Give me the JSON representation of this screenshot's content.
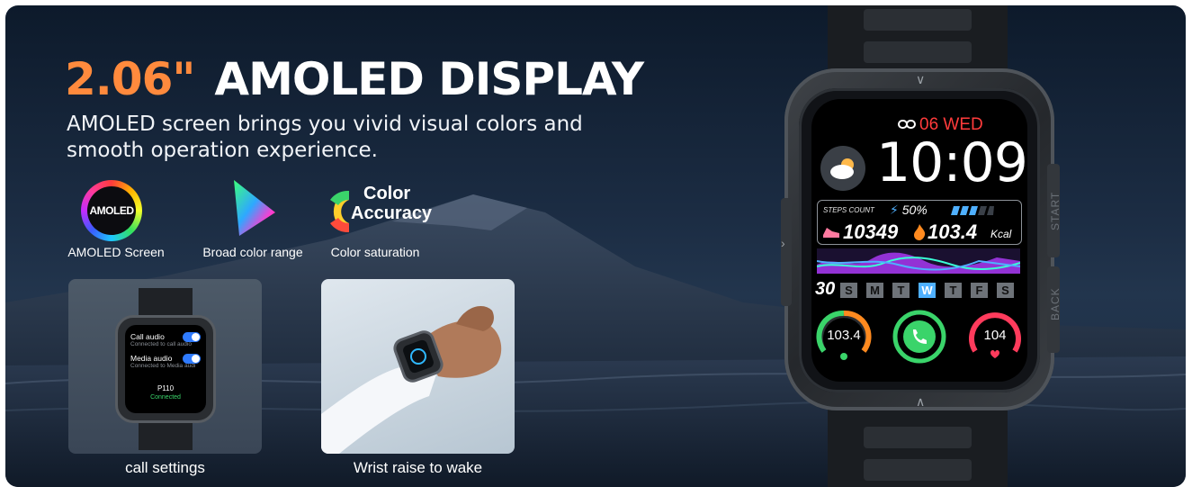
{
  "headline": {
    "size": "2.06\"",
    "title": "AMOLED DISPLAY"
  },
  "subtitle": "AMOLED screen brings you vivid visual colors and smooth operation experience.",
  "features": [
    {
      "icon": "amoled-ring-icon",
      "badge": "AMOLED",
      "label": "AMOLED Screen"
    },
    {
      "icon": "color-prism-icon",
      "label": "Broad color range"
    },
    {
      "icon": "color-wheel-icon",
      "badge_line1": "Color",
      "badge_line2": "Accuracy",
      "label": "Color saturation"
    }
  ],
  "photos": [
    {
      "caption": "call settings",
      "screen": {
        "call_audio": "Call audio",
        "call_audio_note": "Connected to call audio",
        "media_audio": "Media audio",
        "media_audio_note": "Connected to Media audi",
        "device": "P110",
        "status": "Connected"
      }
    },
    {
      "caption": "Wrist raise to wake"
    }
  ],
  "watch": {
    "date": "06 WED",
    "time": "10:09",
    "steps_label": "STEPS COUNT",
    "battery": "50%",
    "steps": "10349",
    "calories": "103.4",
    "calories_unit": "Kcal",
    "week_number": "30",
    "days": [
      "S",
      "M",
      "T",
      "W",
      "T",
      "F",
      "S"
    ],
    "today_index": 3,
    "gauges": [
      "103.4",
      "",
      "104"
    ],
    "buttons": {
      "start": "START",
      "back": "BACK"
    },
    "colors": {
      "date": "#ff3b3b",
      "accent": "#4fb0ff",
      "headline_size": "#ff8a3d"
    }
  }
}
